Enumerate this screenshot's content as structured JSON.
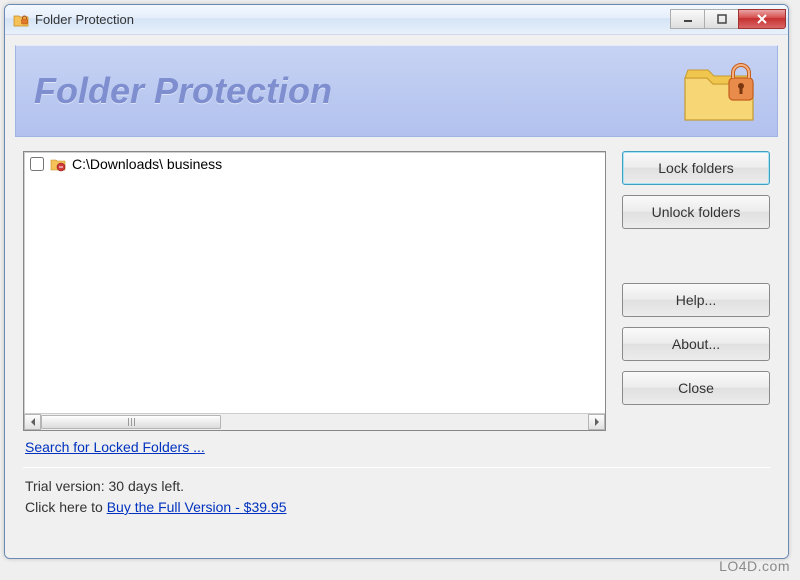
{
  "window": {
    "title": "Folder Protection"
  },
  "header": {
    "appTitle": "Folder Protection"
  },
  "folders": {
    "items": [
      {
        "path": "C:\\Downloads\\ business",
        "checked": false
      }
    ]
  },
  "buttons": {
    "lock": "Lock folders",
    "unlock": "Unlock folders",
    "help": "Help...",
    "about": "About...",
    "close": "Close"
  },
  "links": {
    "search": "Search for Locked Folders ..."
  },
  "footer": {
    "trialLine": "Trial version: 30 days left.",
    "clickHere": "Click here to ",
    "buyLink": "Buy the Full Version - $39.95"
  },
  "watermark": "LO4D.com"
}
